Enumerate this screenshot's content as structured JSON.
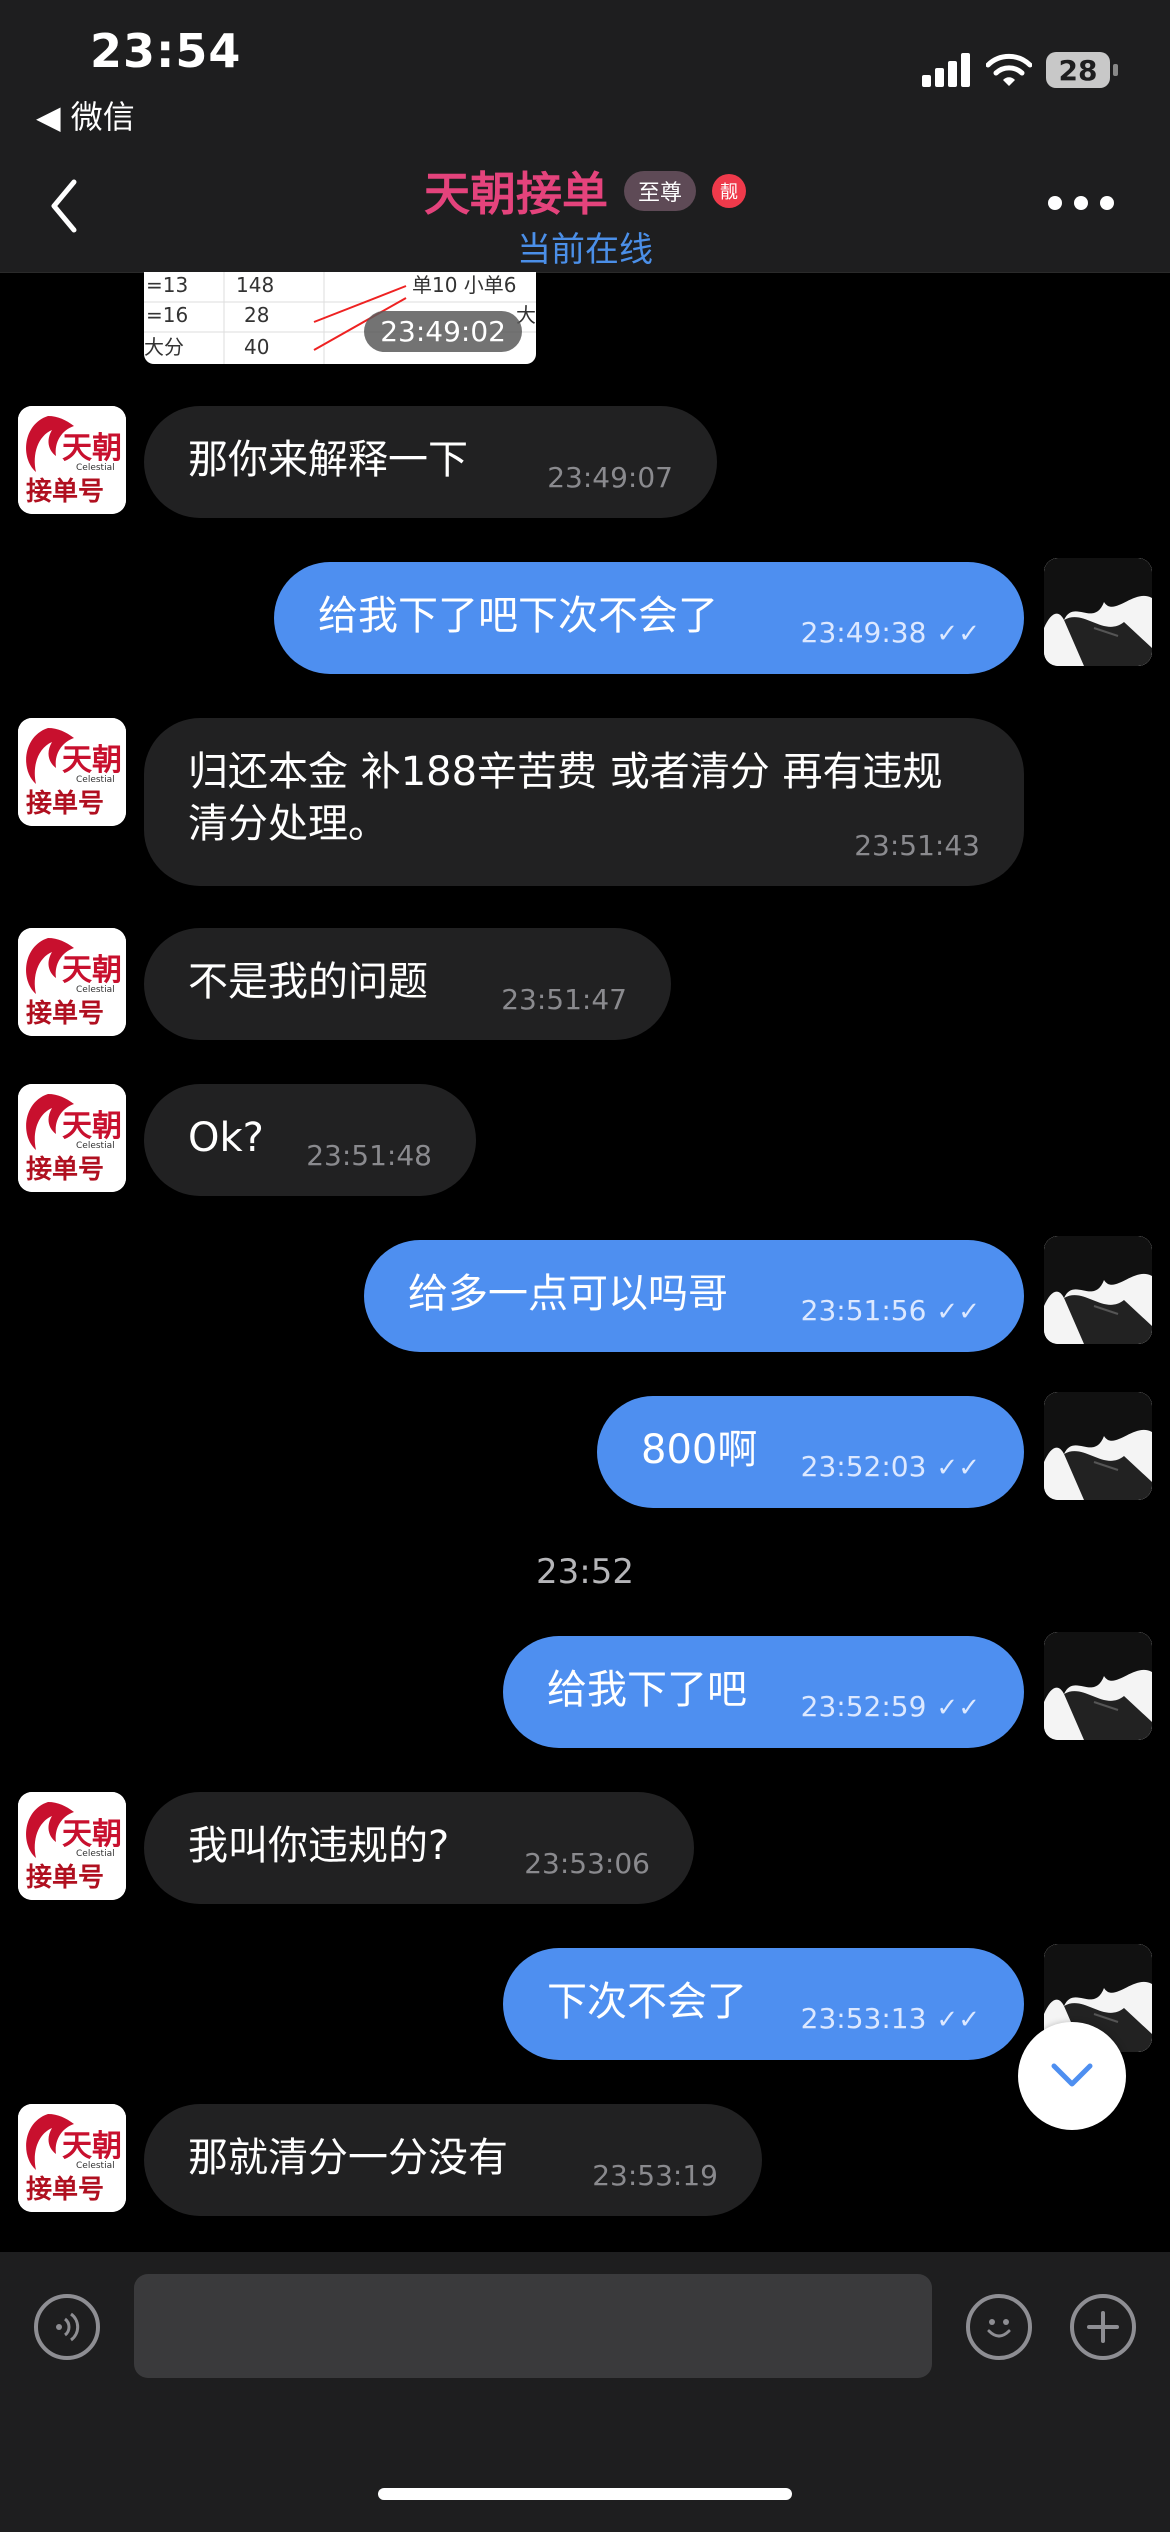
{
  "status_bar": {
    "time": "23:54",
    "back_app": "◀ 微信",
    "battery": "28"
  },
  "header": {
    "title": "天朝接单",
    "vip_badge": "至尊",
    "pretty_badge": "靓",
    "subtitle": "当前在线"
  },
  "image_message": {
    "timestamp": "23:49:02",
    "cells": [
      "=13",
      "148",
      "单10 小单6",
      "=16",
      "28",
      "大",
      "大分",
      "40"
    ]
  },
  "logo_avatar": {
    "line1": "天朝",
    "line2": "接单号",
    "small": "Celestial"
  },
  "messages": [
    {
      "side": "in",
      "text": "那你来解释一下",
      "time": "23:49:07"
    },
    {
      "side": "out",
      "text": "给我下了吧下次不会了",
      "time": "23:49:38",
      "status": "✓✓"
    },
    {
      "side": "in",
      "text": "归还本金 补188辛苦费 或者清分 再有违规清分处理。",
      "time": "23:51:43"
    },
    {
      "side": "in",
      "text": "不是我的问题",
      "time": "23:51:47"
    },
    {
      "side": "in",
      "text": "Ok?",
      "time": "23:51:48"
    },
    {
      "side": "out",
      "text": "给多一点可以吗哥",
      "time": "23:51:56",
      "status": "✓✓"
    },
    {
      "side": "out",
      "text": "800啊",
      "time": "23:52:03",
      "status": "✓✓"
    },
    {
      "side": "out",
      "text": "给我下了吧",
      "time": "23:52:59",
      "status": "✓✓"
    },
    {
      "side": "in",
      "text": "我叫你违规的?",
      "time": "23:53:06"
    },
    {
      "side": "out",
      "text": "下次不会了",
      "time": "23:53:13",
      "status": "✓✓"
    },
    {
      "side": "in",
      "text": "那就清分一分没有",
      "time": "23:53:19"
    }
  ],
  "center_time": "23:52",
  "input": {
    "placeholder": "",
    "value": ""
  },
  "colors": {
    "incoming_bubble": "#212122",
    "outgoing_bubble": "#4e8ff0",
    "title": "#e4437c",
    "online": "#4b8fe8"
  }
}
